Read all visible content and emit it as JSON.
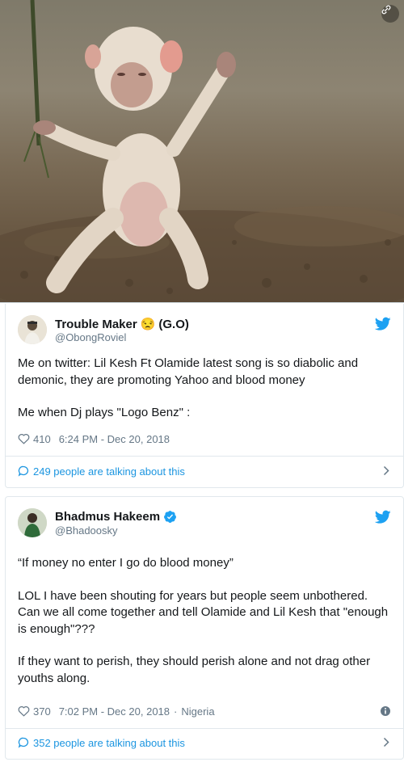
{
  "tweets": [
    {
      "name": "Trouble Maker",
      "emoji": "😒",
      "name_suffix": "(G.O)",
      "handle": "@ObongRoviel",
      "verified": false,
      "paragraphs": [
        "Me on twitter: Lil Kesh Ft Olamide latest song is so diabolic and demonic, they are promoting Yahoo and blood money",
        "Me when Dj plays \"Logo Benz\" :"
      ],
      "likes": "410",
      "timestamp": "6:24 PM - Dec 20, 2018",
      "location": "",
      "talking": "249 people are talking about this"
    },
    {
      "name": "Bhadmus Hakeem",
      "handle": "@Bhadoosky",
      "verified": true,
      "paragraphs": [
        "“If money no enter I go do blood money”",
        "LOL I have been shouting for years but people seem unbothered. Can we all come together and tell Olamide and Lil Kesh that \"enough is enough\"???",
        "If they want to perish, they should perish alone and not drag other youths along."
      ],
      "likes": "370",
      "timestamp": "7:02 PM - Dec 20, 2018",
      "location": "Nigeria",
      "talking": "352 people are talking about this"
    }
  ],
  "colors": {
    "twitter_blue": "#1da1f2",
    "link_blue": "#1b95e0",
    "secondary_text": "#657786",
    "border": "#e1e8ed"
  },
  "icons": [
    "twitter-bird-icon",
    "heart-icon",
    "speech-bubble-icon",
    "chevron-right-icon",
    "info-icon",
    "verified-badge-icon",
    "unfurl-icon"
  ]
}
